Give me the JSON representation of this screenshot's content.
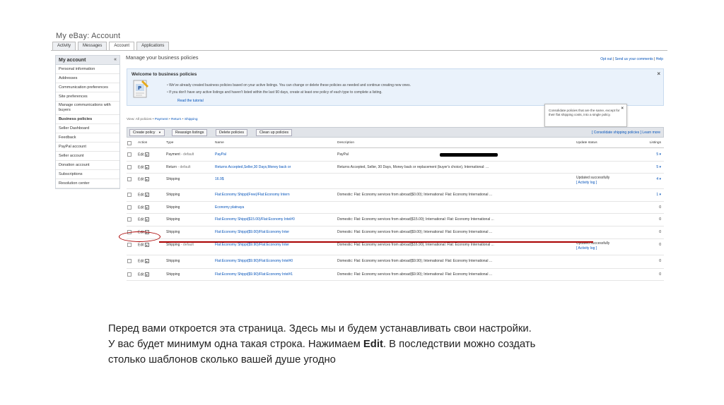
{
  "app": {
    "title": "My eBay: Account"
  },
  "tabs": [
    {
      "label": "Activity"
    },
    {
      "label": "Messages"
    },
    {
      "label": "Account"
    },
    {
      "label": "Applications"
    }
  ],
  "sidebar": {
    "title": "My account",
    "collapse_glyph": "«",
    "items": [
      {
        "label": "Personal information"
      },
      {
        "label": "Addresses"
      },
      {
        "label": "Communication preferences"
      },
      {
        "label": "Site preferences"
      },
      {
        "label": "Manage communications with buyers"
      },
      {
        "label": "Business policies"
      },
      {
        "label": "Seller Dashboard"
      },
      {
        "label": "Feedback"
      },
      {
        "label": "PayPal account"
      },
      {
        "label": "Seller account"
      },
      {
        "label": "Donation account"
      },
      {
        "label": "Subscriptions"
      },
      {
        "label": "Resolution center"
      }
    ]
  },
  "page": {
    "title": "Manage your business policies",
    "links": {
      "opt_out": "Opt out",
      "sep": " | ",
      "send_comments": "Send us your comments",
      "help": "Help"
    }
  },
  "welcome": {
    "title": "Welcome to business policies",
    "bullet1": "We've already created business policies based on your active listings. You can change or delete these policies as needed and continue creating new ones.",
    "bullet2": "If you don't have any active listings and haven't listed within the last 90 days, create at least one policy of each type to complete a listing.",
    "tutorial": "Read the tutorial",
    "close": "×"
  },
  "tooltip": {
    "text": "Consolidate policies that are the same, except for their flat shipping costs, into a single policy.",
    "close": "×"
  },
  "view": {
    "prefix": "View: ",
    "all": "All policies",
    "sep": " • ",
    "payment": "Payment",
    "return": "Return",
    "shipping": "Shipping"
  },
  "toolbar": {
    "create": "Create policy",
    "create_caret": "▼",
    "reassign": "Reassign listings",
    "delete": "Delete policies",
    "cleanup": "Clean up policies",
    "consolidate": "[ Consolidate shipping policies ]",
    "learn": " Learn more"
  },
  "table": {
    "headers": {
      "action": "Action",
      "type": "Type",
      "name": "Name",
      "description": "Description",
      "update": "Update status",
      "listings": "Listings"
    },
    "edit_label": "Edit",
    "edit_caret": "▾",
    "rows": [
      {
        "type": "Payment",
        "type_suffix": " - default",
        "name": "PayPal",
        "desc": "PayPal",
        "update": "",
        "activity": "",
        "count": "5",
        "count_caret": " ▾"
      },
      {
        "type": "Return",
        "type_suffix": " - default",
        "name": "Returns Accepted,Seller,30 Days,Money back or",
        "desc": "Returns Accepted, Seller, 30 Days, Money back or replacement (buyer's choice), International: ...",
        "update": "",
        "activity": "",
        "count": "5",
        "count_caret": " ▾"
      },
      {
        "type": "Shipping",
        "type_suffix": "",
        "name": "16.9$",
        "desc": "",
        "update": "Updated successfully",
        "activity": "[ Activity log ]",
        "count": "4",
        "count_caret": " ▾"
      },
      {
        "type": "Shipping",
        "type_suffix": "",
        "name": "Flat:Economy Shippi(Free)/Flat:Economy Intern",
        "desc": "Domestic: Flat: Economy services from abroad($0.00); International: Flat: Economy International ...",
        "update": "",
        "activity": "",
        "count": "1",
        "count_caret": " ▾"
      },
      {
        "type": "Shipping",
        "type_suffix": "",
        "name": "Economy platnaya",
        "desc": "",
        "update": "",
        "activity": "",
        "count": "0",
        "count_caret": ""
      },
      {
        "type": "Shipping",
        "type_suffix": "",
        "name": "Flat:Economy Shippi($15.00)/Flat:Economy Intel#0",
        "desc": "Domestic: Flat: Economy services from abroad($15.00); International: Flat: Economy International ...",
        "update": "",
        "activity": "",
        "count": "0",
        "count_caret": ""
      },
      {
        "type": "Shipping",
        "type_suffix": "",
        "name": "Flat:Economy Shippi($9.00)/Flat:Economy Inter",
        "desc": "Domestic: Flat: Economy services from abroad($9.00); International: Flat: Economy International ...",
        "update": "",
        "activity": "",
        "count": "0",
        "count_caret": ""
      },
      {
        "type": "Shipping",
        "type_suffix": " - default",
        "name": "Flat:Economy Shippi($9.90)/Flat:Economy Inter",
        "desc": "Domestic: Flat: Economy services from abroad($16.90); International: Flat: Economy International ...",
        "update": "Updated successfully",
        "activity": "[ Activity log ]",
        "count": "0",
        "count_caret": ""
      },
      {
        "type": "Shipping",
        "type_suffix": "",
        "name": "Flat:Economy Shippi($9.90)/Flat:Economy Intel#0",
        "desc": "Domestic: Flat: Economy services from abroad($9.90); International: Flat: Economy International ...",
        "update": "",
        "activity": "",
        "count": "0",
        "count_caret": ""
      },
      {
        "type": "Shipping",
        "type_suffix": "",
        "name": "Flat:Economy Shippi($9.90)/Flat:Economy Intel#1",
        "desc": "Domestic: Flat: Economy services from abroad($9.90); International: Flat: Economy International ...",
        "update": "",
        "activity": "",
        "count": "0",
        "count_caret": ""
      }
    ]
  },
  "caption": {
    "line1": "Перед вами откроется эта страница. Здесь мы и будем устанавливать свои настройки.",
    "line2a": "У вас будет минимум одна такая строка. Нажимаем ",
    "line2b": "Edit",
    "line2c": ". В последствии можно создать",
    "line3": "столько шаблонов сколько вашей душе угодно"
  },
  "colors": {
    "link": "#0654ba",
    "annotation": "#aa0000",
    "toolbar_bg": "#e1e4e9",
    "welcome_bg": "#eaf2fb"
  }
}
